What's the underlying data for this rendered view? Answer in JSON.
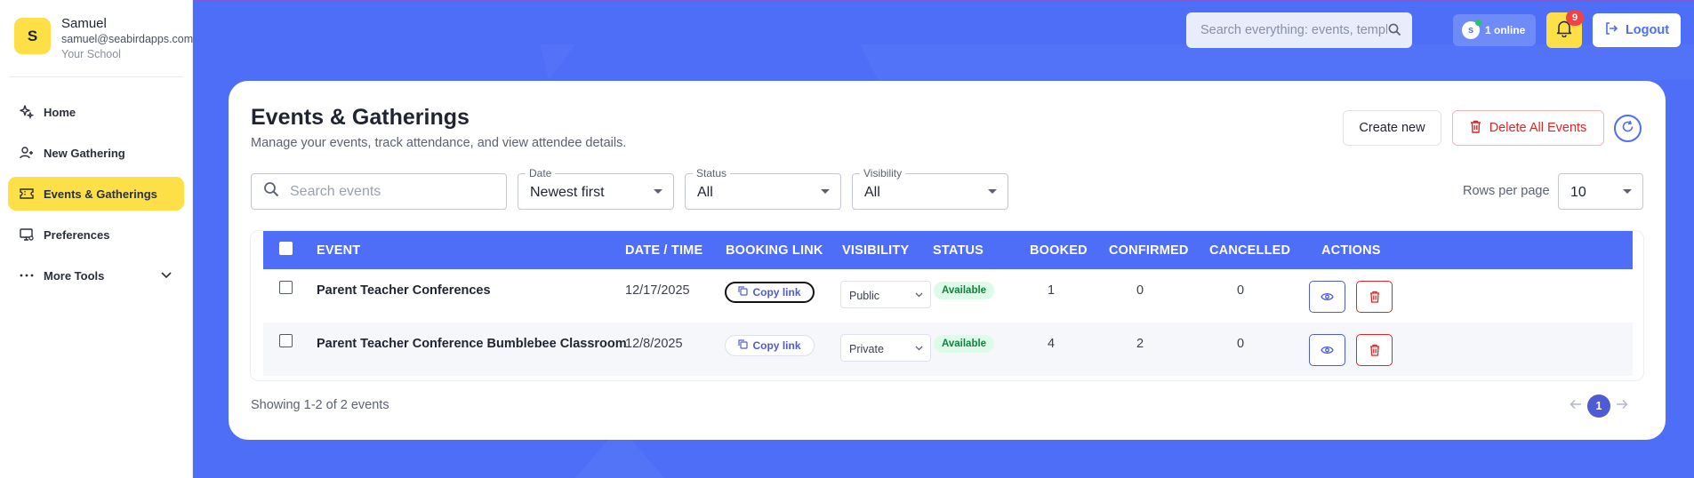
{
  "sidebar": {
    "profile": {
      "initial": "S",
      "name": "Samuel",
      "email": "samuel@seabirdapps.com",
      "school": "Your School"
    },
    "items": [
      {
        "label": "Home",
        "icon": "sparkle-icon",
        "active": false
      },
      {
        "label": "New Gathering",
        "icon": "user-plus-icon",
        "active": false
      },
      {
        "label": "Events & Gatherings",
        "icon": "ticket-icon",
        "active": true
      },
      {
        "label": "Preferences",
        "icon": "monitor-icon",
        "active": false
      },
      {
        "label": "More Tools",
        "icon": "dots-icon",
        "active": false
      }
    ]
  },
  "topbar": {
    "search_placeholder": "Search everything: events, templates...",
    "online_initial": "s",
    "online_label": "1 online",
    "notification_count": "9",
    "logout_label": "Logout"
  },
  "page": {
    "title": "Events & Gatherings",
    "subtitle": "Manage your events, track attendance, and view attendee details.",
    "create_label": "Create new",
    "delete_all_label": "Delete All Events"
  },
  "filters": {
    "search_placeholder": "Search events",
    "date": {
      "label": "Date",
      "value": "Newest first"
    },
    "status": {
      "label": "Status",
      "value": "All"
    },
    "visibility": {
      "label": "Visibility",
      "value": "All"
    },
    "rows_per_page_label": "Rows per page",
    "rows_per_page_value": "10"
  },
  "table": {
    "columns": [
      "EVENT",
      "DATE / TIME",
      "BOOKING LINK",
      "VISIBILITY",
      "STATUS",
      "BOOKED",
      "CONFIRMED",
      "CANCELLED",
      "ACTIONS"
    ],
    "copy_label": "Copy link",
    "rows": [
      {
        "event": "Parent Teacher Conferences",
        "date": "12/17/2025",
        "visibility": "Public",
        "status": "Available",
        "booked": "1",
        "confirmed": "0",
        "cancelled": "0"
      },
      {
        "event": "Parent Teacher Conference Bumblebee Classroom",
        "date": "12/8/2025",
        "visibility": "Private",
        "status": "Available",
        "booked": "4",
        "confirmed": "2",
        "cancelled": "0"
      }
    ]
  },
  "footer": {
    "showing": "Showing 1-2 of 2 events",
    "current_page": "1"
  },
  "colors": {
    "brand": "#4f6ef7",
    "accent_yellow": "#fde047",
    "danger": "#dc2626",
    "success_bg": "#dcfce7"
  }
}
